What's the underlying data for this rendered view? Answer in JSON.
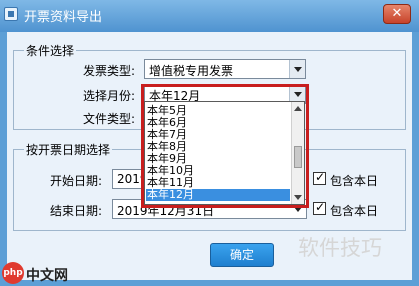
{
  "window": {
    "title": "开票资料导出",
    "close_glyph": "✕"
  },
  "condition_group": {
    "legend": "条件选择",
    "invoice_type_label": "发票类型:",
    "invoice_type_value": "增值税专用发票",
    "month_label": "选择月份:",
    "month_value": "本年12月",
    "file_type_label": "文件类型:"
  },
  "month_dropdown": {
    "items": [
      "本年5月",
      "本年6月",
      "本年7月",
      "本年8月",
      "本年9月",
      "本年10月",
      "本年11月",
      "本年12月"
    ],
    "selected": "本年12月"
  },
  "date_group": {
    "legend": "按开票日期选择",
    "start_label": "开始日期:",
    "start_value": "2019",
    "end_label": "结束日期:",
    "end_value": "2019年12月31日",
    "include_today_label_1": "包含本日",
    "include_today_label_2": "包含本日"
  },
  "buttons": {
    "ok_label": "确定"
  },
  "watermark": {
    "text": "软件技巧",
    "logo_badge": "php",
    "logo_text": "中文网"
  },
  "colors": {
    "titlebar": "#4f93d0",
    "highlight": "#c81e1e",
    "selection": "#3a8fe0",
    "ok_button": "#1f7fcf"
  }
}
